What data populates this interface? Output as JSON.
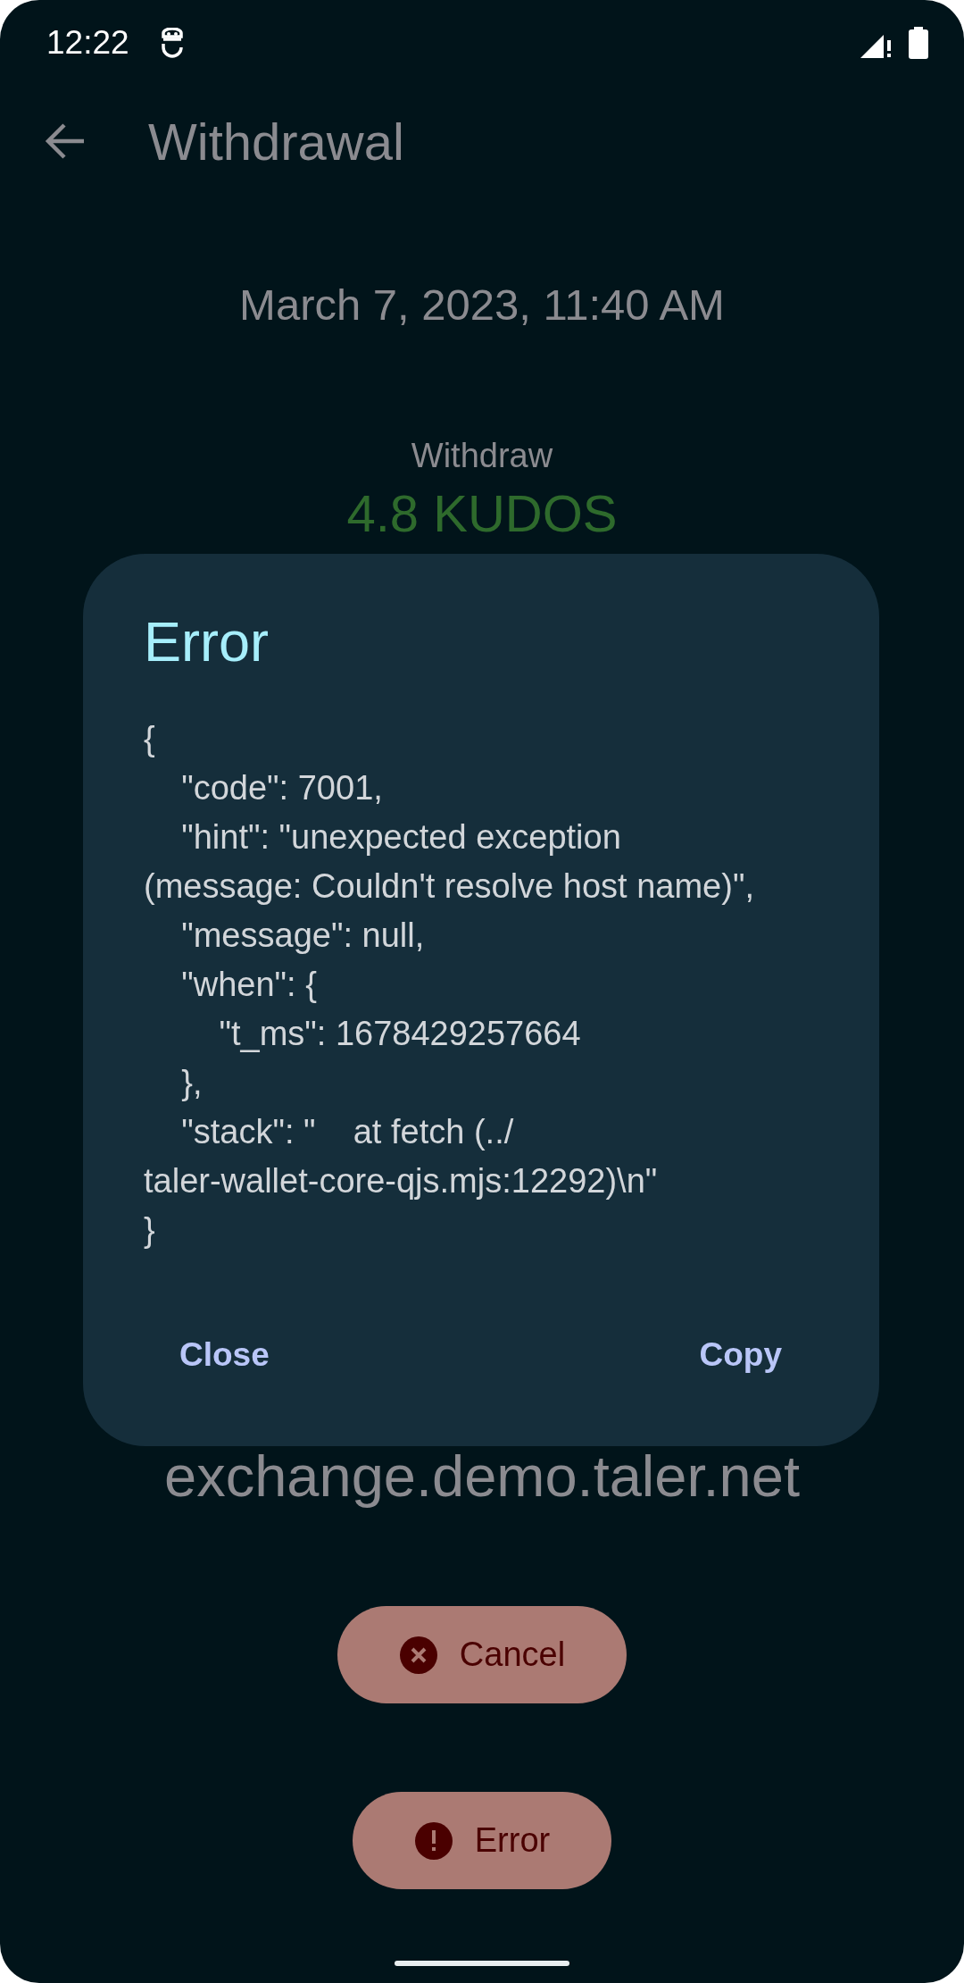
{
  "status_bar": {
    "time": "12:22"
  },
  "toolbar": {
    "title": "Withdrawal"
  },
  "transaction": {
    "date": "March 7, 2023, 11:40 AM",
    "label": "Withdraw",
    "amount": "4.8 KUDOS",
    "exchange": "exchange.demo.taler.net"
  },
  "actions": [
    {
      "label": "Cancel",
      "kind": "cancel"
    },
    {
      "label": "Error",
      "kind": "error"
    }
  ],
  "dialog": {
    "title": "Error",
    "body": "{\n    \"code\": 7001,\n    \"hint\": \"unexpected exception\n(message: Couldn't resolve host name)\",\n    \"message\": null,\n    \"when\": {\n        \"t_ms\": 1678429257664\n    },\n    \"stack\": \"    at fetch (../\ntaler-wallet-core-qjs.mjs:12292)\\n\"\n}",
    "buttons": [
      "Close",
      "Copy"
    ]
  }
}
